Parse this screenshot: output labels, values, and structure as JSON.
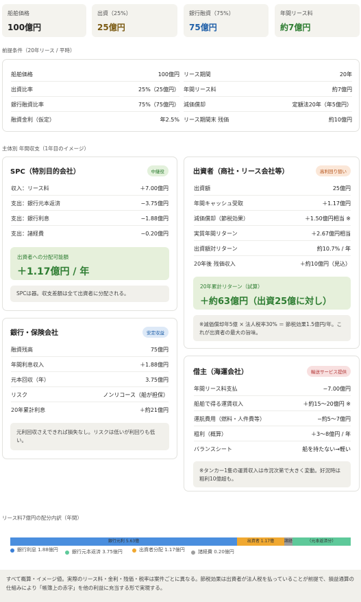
{
  "kpis": [
    {
      "label": "船舶価格",
      "value": "100億円",
      "color": "#222222"
    },
    {
      "label": "出資（25%）",
      "value": "25億円",
      "color": "#7a5a12"
    },
    {
      "label": "銀行融資（75%）",
      "value": "75億円",
      "color": "#1f5fa8"
    },
    {
      "label": "年間リース料",
      "value": "約7億円",
      "color": "#2e7d32"
    }
  ],
  "premise": {
    "title": "前提条件（20年リース / 平時）",
    "left": [
      {
        "k": "船舶価格",
        "v": "100億円"
      },
      {
        "k": "出資比率",
        "v": "25%（25億円）"
      },
      {
        "k": "銀行融資比率",
        "v": "75%（75億円）"
      },
      {
        "k": "融資金利（仮定）",
        "v": "年2.5%"
      }
    ],
    "right": [
      {
        "k": "リース期間",
        "v": "20年"
      },
      {
        "k": "年間リース料",
        "v": "約7億円"
      },
      {
        "k": "減価償却",
        "v": "定額法20年（年5億円）"
      },
      {
        "k": "リース期間末 残価",
        "v": "約10億円"
      }
    ]
  },
  "section2_title": "主体別 年間収支（1年目のイメージ）",
  "spc": {
    "title": "SPC（特別目的会社）",
    "badge": "中継役",
    "rows": [
      {
        "k": "収入：リース料",
        "v": "＋7.00億円"
      },
      {
        "k": "支出：銀行元本返済",
        "v": "−3.75億円"
      },
      {
        "k": "支出：銀行利息",
        "v": "−1.88億円"
      },
      {
        "k": "支出：諸経費",
        "v": "−0.20億円"
      }
    ],
    "hl_title": "出資者への分配可能額",
    "hl_value": "＋1.17億円 / 年",
    "note": "SPCは器。収支差額は全て出資者に分配される。"
  },
  "bank": {
    "title": "銀行・保険会社",
    "badge": "安定収益",
    "rows": [
      {
        "k": "融資残高",
        "v": "75億円"
      },
      {
        "k": "年間利息収入",
        "v": "＋1.88億円"
      },
      {
        "k": "元本回収（年）",
        "v": "3.75億円"
      },
      {
        "k": "リスク",
        "v": "ノンリコース（船が担保）"
      },
      {
        "k": "20年累計利息",
        "v": "＋約21億円"
      }
    ],
    "note": "元利回収さえできれば損失なし。リスクは低いが利回りも低い。"
  },
  "investor": {
    "title": "出資者（商社・リース会社等）",
    "badge": "高利回り狙い",
    "rows": [
      {
        "k": "出資額",
        "v": "25億円"
      },
      {
        "k": "年間キャッシュ受取",
        "v": "＋1.17億円"
      },
      {
        "k": "減価償却（節税効果）",
        "v": "＋1.50億円相当 ※"
      },
      {
        "k": "実質年間リターン",
        "v": "＋2.67億円相当"
      },
      {
        "k": "出資額対リターン",
        "v": "約10.7% / 年"
      },
      {
        "k": "20年後 残価収入",
        "v": "＋約10億円（見込）"
      }
    ],
    "hl_title": "20年累計リターン（試算）",
    "hl_value": "＋約63億円（出資25億に対し）",
    "note": "※減価償却年5億 × 法人税率30% ＝ 節税効果1.5億円/年。これが出資者の最大の旨味。"
  },
  "shipowner": {
    "title": "借主（海運会社）",
    "badge": "輸送サービス提供",
    "rows": [
      {
        "k": "年間リース料支払",
        "v": "−7.00億円"
      },
      {
        "k": "船舶で得る運賃収入",
        "v": "＋約15〜20億円 ※"
      },
      {
        "k": "運航費用（燃料・人件費等）",
        "v": "−約5〜7億円"
      },
      {
        "k": "粗利（概算）",
        "v": "＋3〜8億円 / 年"
      },
      {
        "k": "バランスシート",
        "v": "船を持たない→軽い"
      }
    ],
    "note": "※タンカー1隻の運賃収入は市況次第で大きく変動。好況時は粗利10億超も。"
  },
  "breakdown": {
    "title": "リース料7億円の配分内訳（年間）",
    "segments": [
      {
        "label": "銀行元利 5.63億",
        "value": 5.63,
        "color": "#4a8ede"
      },
      {
        "label": "出資者 1.17億",
        "value": 1.17,
        "color": "#f0a830"
      },
      {
        "label": "諸経",
        "value": 0.2,
        "color": "#9e9e9e"
      },
      {
        "label": "（元本返済分）",
        "value": 1.45,
        "color": "#5ec99a"
      }
    ],
    "legend": [
      {
        "label": "銀行利息 1.88億円",
        "color": "#3b7fd6"
      },
      {
        "label": "銀行元本返済 3.75億円",
        "color": "#5ec99a"
      },
      {
        "label": "出資者分配 1.17億円",
        "color": "#f0a830"
      },
      {
        "label": "諸経費 0.20億円",
        "color": "#9e9e9e"
      }
    ]
  },
  "footer": "すべて概算・イメージ値。実際のリース料・金利・残価・税率は案件ごとに異なる。節税効果は出資者が法人税を払っていることが前提で、損益通算の仕組みにより「帳簿上の赤字」を他の利益に充当する形で実現する。"
}
